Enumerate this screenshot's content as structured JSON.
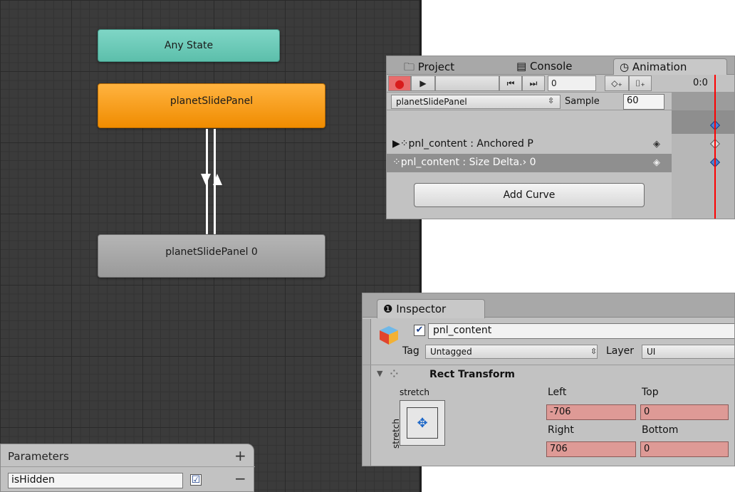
{
  "animator": {
    "any_state": "Any State",
    "state_main": "planetSlidePanel",
    "state_sub": "planetSlidePanel 0"
  },
  "parameters": {
    "title": "Parameters",
    "add": "+",
    "remove": "−",
    "items": [
      {
        "name": "isHidden",
        "value": true,
        "check": "☑"
      }
    ]
  },
  "animation": {
    "tabs": {
      "project": "🗀 Project",
      "console": "▤ Console",
      "animation": "◷ Animation"
    },
    "toolbar": {
      "record": "●",
      "play": "▶",
      "prev": "⏮",
      "next": "⏭",
      "frame": "0",
      "add_key": "◇₊",
      "add_event": "⌷₊",
      "timecode": "0:0"
    },
    "clip": "planetSlidePanel",
    "sample_label": "Sample",
    "sample_value": "60",
    "properties": [
      {
        "label": "▶⁘pnl_content : Anchored P",
        "key": "◈"
      },
      {
        "label": " ⁘pnl_content : Size Delta.› 0",
        "key": "◈"
      }
    ],
    "add_curve": "Add Curve"
  },
  "inspector": {
    "tab": "❶ Inspector",
    "object_name": "pnl_content",
    "active_check": "✔",
    "tag_label": "Tag",
    "tag_value": "Untagged",
    "layer_label": "Layer",
    "layer_value": "UI",
    "component": "Rect Transform",
    "anchor_preset_top": "stretch",
    "anchor_preset_side": "stretch",
    "fields": {
      "left_label": "Left",
      "left": "-706",
      "top_label": "Top",
      "top": "0",
      "right_label": "Right",
      "right": "706",
      "bottom_label": "Bottom",
      "bottom": "0"
    },
    "colors": {
      "animated_field": "#de9a96",
      "accent": "#f08c00"
    }
  }
}
